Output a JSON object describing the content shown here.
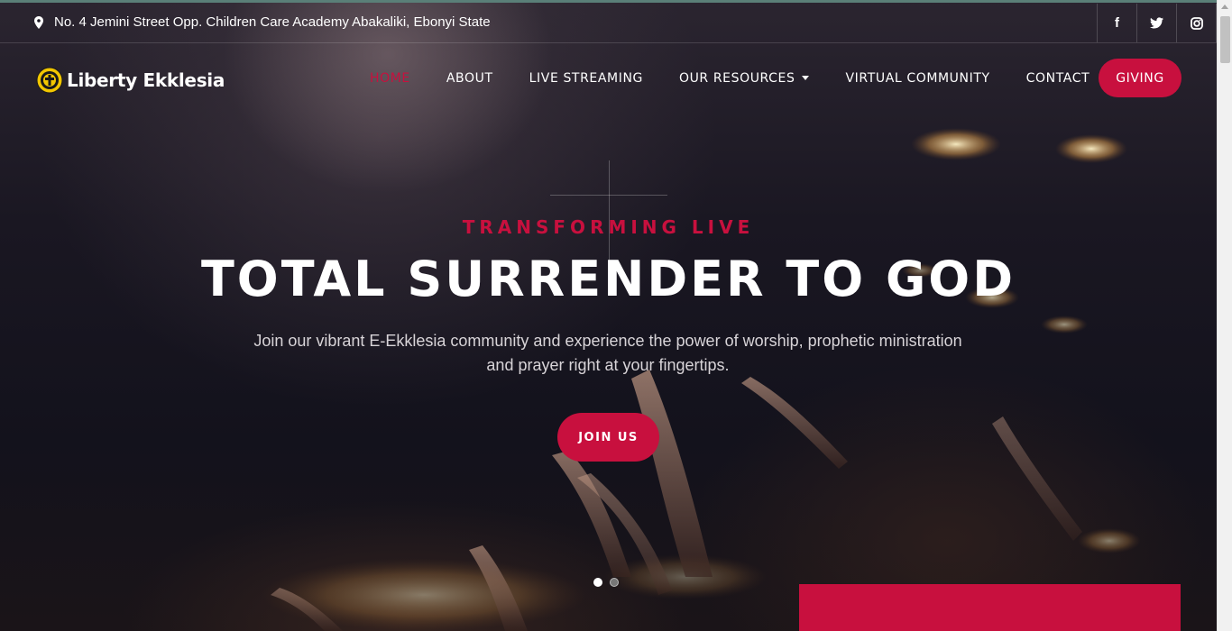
{
  "topbar": {
    "address": "No. 4 Jemini Street Opp. Children Care Academy Abakaliki, Ebonyi State",
    "social": [
      {
        "icon": "facebook-icon",
        "glyph": "f"
      },
      {
        "icon": "twitter-icon",
        "glyph": ""
      },
      {
        "icon": "instagram-icon",
        "glyph": ""
      }
    ]
  },
  "brand": {
    "name": "Liberty Ekklesia"
  },
  "nav": {
    "items": [
      {
        "label": "HOME",
        "active": true
      },
      {
        "label": "ABOUT"
      },
      {
        "label": "LIVE STREAMING"
      },
      {
        "label": "OUR RESOURCES",
        "dropdown": true
      },
      {
        "label": "VIRTUAL COMMUNITY"
      },
      {
        "label": "CONTACT"
      }
    ],
    "cta": "GIVING"
  },
  "hero": {
    "kicker": "TRANSFORMING LIVE",
    "headline": "TOTAL SURRENDER TO GOD",
    "subtext": "Join our vibrant E-Ekklesia community and experience the power of worship, prophetic ministration and prayer right at your fingertips.",
    "button": "JOIN US",
    "slides": {
      "count": 2,
      "active": 1
    }
  },
  "colors": {
    "accent": "#c8103e",
    "text": "#ffffff",
    "background": "#13121c"
  }
}
